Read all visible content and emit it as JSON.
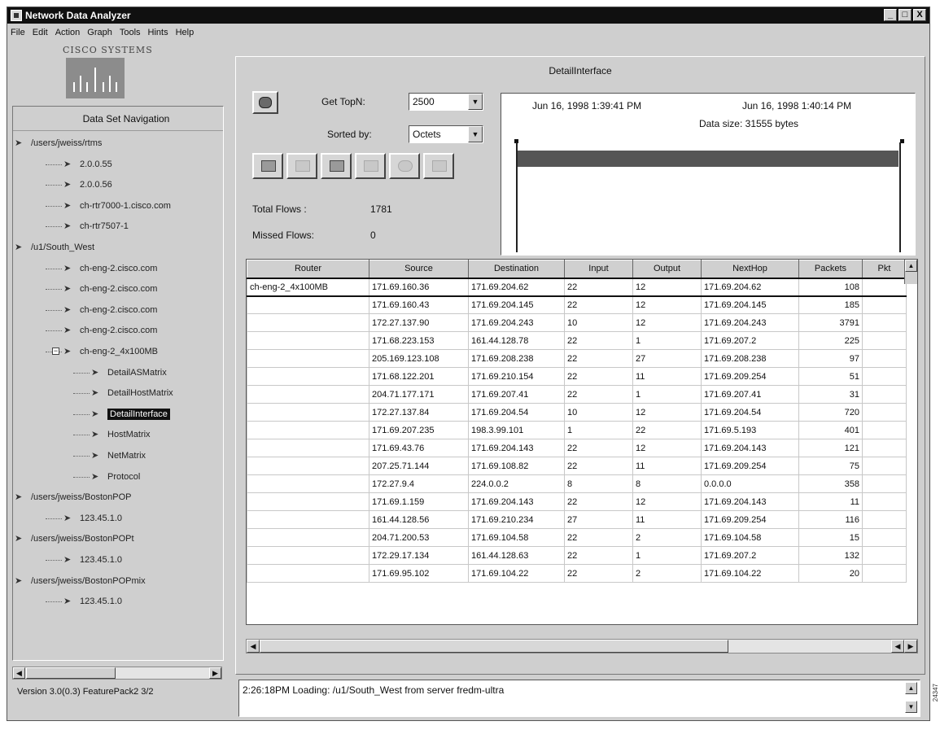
{
  "window": {
    "title": "Network Data Analyzer",
    "buttons": [
      "_",
      "□",
      "X"
    ]
  },
  "menu": [
    "File",
    "Edit",
    "Action",
    "Graph",
    "Tools",
    "Hints",
    "Help"
  ],
  "logo": {
    "text": "CISCO SYSTEMS"
  },
  "navigation": {
    "header": "Data Set Navigation",
    "items": [
      {
        "label": "/users/jweiss/rtms",
        "level": 0
      },
      {
        "label": "2.0.0.55",
        "level": 2
      },
      {
        "label": "2.0.0.56",
        "level": 2
      },
      {
        "label": "ch-rtr7000-1.cisco.com",
        "level": 2
      },
      {
        "label": "ch-rtr7507-1",
        "level": 2
      },
      {
        "label": "/u1/South_West",
        "level": 0
      },
      {
        "label": "ch-eng-2.cisco.com",
        "level": 2
      },
      {
        "label": "ch-eng-2.cisco.com",
        "level": 2
      },
      {
        "label": "ch-eng-2.cisco.com",
        "level": 2
      },
      {
        "label": "ch-eng-2.cisco.com",
        "level": 2
      },
      {
        "label": "ch-eng-2_4x100MB",
        "level": 2,
        "expanded": true
      },
      {
        "label": "DetailASMatrix",
        "level": 3
      },
      {
        "label": "DetailHostMatrix",
        "level": 3
      },
      {
        "label": "DetailInterface",
        "level": 3,
        "selected": true
      },
      {
        "label": "HostMatrix",
        "level": 3
      },
      {
        "label": "NetMatrix",
        "level": 3
      },
      {
        "label": "Protocol",
        "level": 3
      },
      {
        "label": "/users/jweiss/BostonPOP",
        "level": 0
      },
      {
        "label": "123.45.1.0",
        "level": 2
      },
      {
        "label": "/users/jweiss/BostonPOPt",
        "level": 0
      },
      {
        "label": "123.45.1.0",
        "level": 2
      },
      {
        "label": "/users/jweiss/BostonPOPmix",
        "level": 0
      },
      {
        "label": "123.45.1.0",
        "level": 2
      }
    ]
  },
  "version": "Version 3.0(0.3) FeaturePack2 3/2",
  "main": {
    "title": "DetailInterface",
    "get_topn_label": "Get TopN:",
    "get_topn_value": "2500",
    "sorted_by_label": "Sorted by:",
    "sorted_by_value": "Octets",
    "total_flows_label": "Total Flows :",
    "total_flows_value": "1781",
    "missed_flows_label": "Missed Flows:",
    "missed_flows_value": "0"
  },
  "timeline": {
    "start": "Jun 16, 1998 1:39:41 PM",
    "end": "Jun 16, 1998 1:40:14 PM",
    "data_size": "Data size: 31555 bytes"
  },
  "table": {
    "columns": [
      "Router",
      "Source",
      "Destination",
      "Input",
      "Output",
      "NextHop",
      "Packets",
      "Pkt"
    ],
    "rows": [
      [
        "ch-eng-2_4x100MB",
        "171.69.160.36",
        "171.69.204.62",
        "22",
        "12",
        "171.69.204.62",
        "108"
      ],
      [
        "",
        "171.69.160.43",
        "171.69.204.145",
        "22",
        "12",
        "171.69.204.145",
        "185"
      ],
      [
        "",
        "172.27.137.90",
        "171.69.204.243",
        "10",
        "12",
        "171.69.204.243",
        "3791"
      ],
      [
        "",
        "171.68.223.153",
        "161.44.128.78",
        "22",
        "1",
        "171.69.207.2",
        "225"
      ],
      [
        "",
        "205.169.123.108",
        "171.69.208.238",
        "22",
        "27",
        "171.69.208.238",
        "97"
      ],
      [
        "",
        "171.68.122.201",
        "171.69.210.154",
        "22",
        "11",
        "171.69.209.254",
        "51"
      ],
      [
        "",
        "204.71.177.171",
        "171.69.207.41",
        "22",
        "1",
        "171.69.207.41",
        "31"
      ],
      [
        "",
        "172.27.137.84",
        "171.69.204.54",
        "10",
        "12",
        "171.69.204.54",
        "720"
      ],
      [
        "",
        "171.69.207.235",
        "198.3.99.101",
        "1",
        "22",
        "171.69.5.193",
        "401"
      ],
      [
        "",
        "171.69.43.76",
        "171.69.204.143",
        "22",
        "12",
        "171.69.204.143",
        "121"
      ],
      [
        "",
        "207.25.71.144",
        "171.69.108.82",
        "22",
        "11",
        "171.69.209.254",
        "75"
      ],
      [
        "",
        "172.27.9.4",
        "224.0.0.2",
        "8",
        "8",
        "0.0.0.0",
        "358"
      ],
      [
        "",
        "171.69.1.159",
        "171.69.204.143",
        "22",
        "12",
        "171.69.204.143",
        "11"
      ],
      [
        "",
        "161.44.128.56",
        "171.69.210.234",
        "27",
        "11",
        "171.69.209.254",
        "116"
      ],
      [
        "",
        "204.71.200.53",
        "171.69.104.58",
        "22",
        "2",
        "171.69.104.58",
        "15"
      ],
      [
        "",
        "172.29.17.134",
        "161.44.128.63",
        "22",
        "1",
        "171.69.207.2",
        "132"
      ],
      [
        "",
        "171.69.95.102",
        "171.69.104.22",
        "22",
        "2",
        "171.69.104.22",
        "20"
      ]
    ]
  },
  "status": "2:26:18PM   Loading: /u1/South_West from server fredm-ultra",
  "side_code": "24347"
}
